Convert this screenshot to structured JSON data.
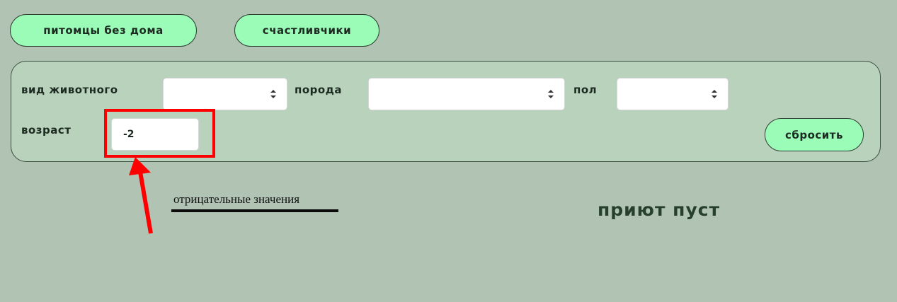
{
  "tabs": {
    "homeless_label": "питомцы без дома",
    "lucky_label": "счастливчики"
  },
  "filters": {
    "animal_type_label": "вид животного",
    "animal_type_value": "",
    "breed_label": "порода",
    "breed_value": "",
    "sex_label": "пол",
    "sex_value": "",
    "age_label": "возраст",
    "age_value": "-2",
    "reset_label": "сбросить"
  },
  "annotation": {
    "text": "отрицательные значения",
    "color": "#ff0000"
  },
  "main": {
    "empty_message": "приют пуст"
  },
  "colors": {
    "background": "#b1c4b4",
    "panel": "#b8d2bb",
    "button": "#9bfcb8",
    "empty_message": "#26402c"
  }
}
